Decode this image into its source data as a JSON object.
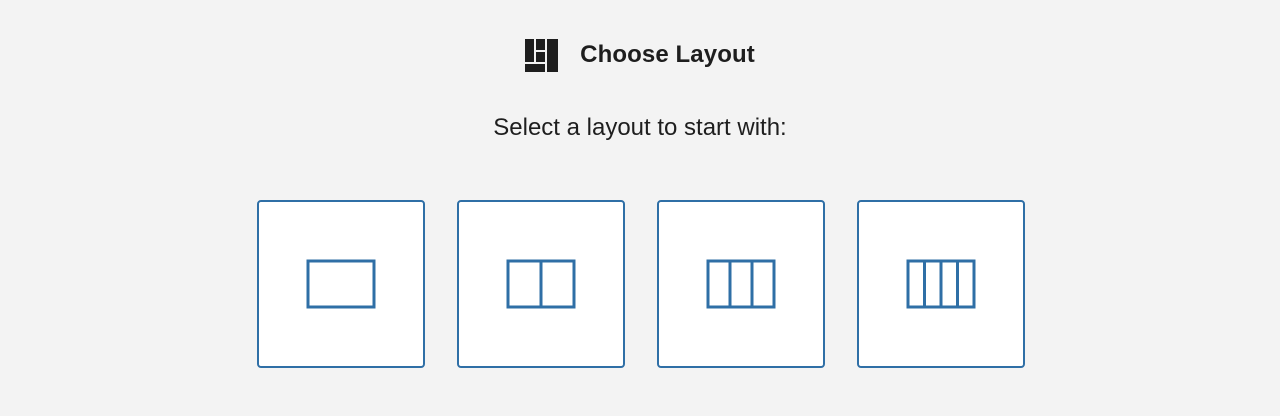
{
  "header": {
    "title": "Choose Layout",
    "icon": "layout-grid-icon"
  },
  "subtitle": "Select a layout to start with:",
  "accent_color": "#2f6fa6",
  "layouts": [
    {
      "columns": 1,
      "icon": "one-column-layout-icon"
    },
    {
      "columns": 2,
      "icon": "two-column-layout-icon"
    },
    {
      "columns": 3,
      "icon": "three-column-layout-icon"
    },
    {
      "columns": 4,
      "icon": "four-column-layout-icon"
    }
  ]
}
